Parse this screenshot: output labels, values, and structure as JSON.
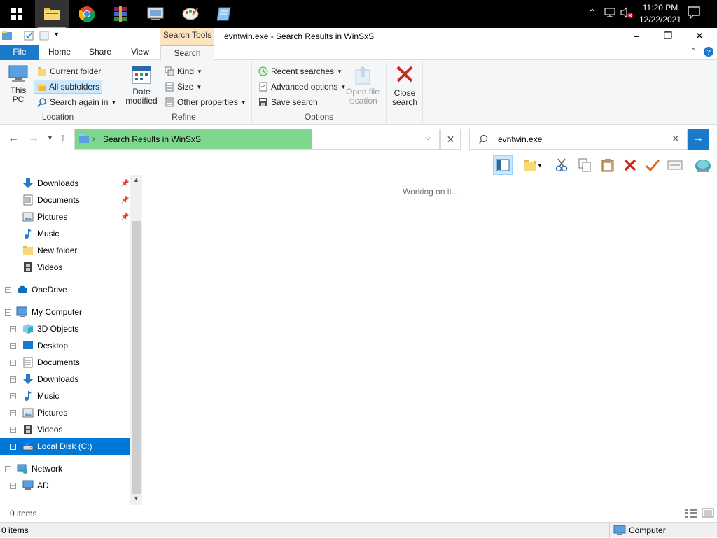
{
  "taskbar": {
    "time": "11:20 PM",
    "date": "12/22/2021",
    "apps": [
      "file-explorer",
      "chrome",
      "winrar",
      "system-info",
      "paint",
      "notepad"
    ]
  },
  "window": {
    "title": "evntwin.exe - Search Results in WinSxS",
    "contextual_tab": "Search Tools"
  },
  "ribbon_tabs": [
    "File",
    "Home",
    "Share",
    "View",
    "Search"
  ],
  "ribbon": {
    "location": {
      "label": "Location",
      "this_pc": "This PC",
      "current_folder": "Current folder",
      "all_subfolders": "All subfolders",
      "search_again_in": "Search again in"
    },
    "refine": {
      "label": "Refine",
      "date_modified": "Date modified",
      "kind": "Kind",
      "size": "Size",
      "other_properties": "Other properties"
    },
    "options": {
      "label": "Options",
      "recent_searches": "Recent searches",
      "advanced_options": "Advanced options",
      "save_search": "Save search",
      "open_file_location": "Open file location"
    },
    "close_search": "Close search"
  },
  "address": {
    "path": "Search Results in WinSxS",
    "progress": 0.65
  },
  "search": {
    "value": "evntwin.exe"
  },
  "nav": {
    "quick_access": [
      "Downloads",
      "Documents",
      "Pictures",
      "Music",
      "New folder",
      "Videos"
    ],
    "onedrive": "OneDrive",
    "my_computer": "My Computer",
    "computer_items": [
      "3D Objects",
      "Desktop",
      "Documents",
      "Downloads",
      "Music",
      "Pictures",
      "Videos",
      "Local Disk (C:)"
    ],
    "network": "Network",
    "network_items": [
      "AD"
    ]
  },
  "content": {
    "status_message": "Working on it..."
  },
  "status": {
    "items_count": "0 items",
    "items_count_bottom": "0 items",
    "location": "Computer"
  }
}
